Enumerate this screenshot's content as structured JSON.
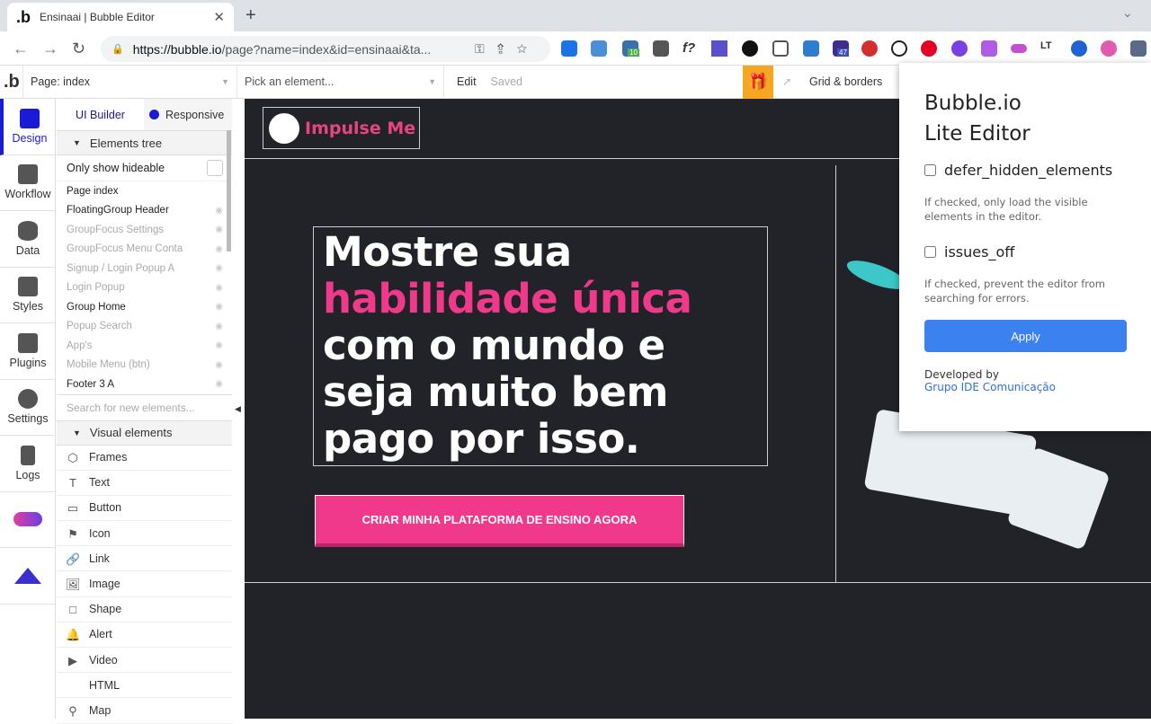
{
  "browser": {
    "tab_title": "Ensinaai | Bubble Editor",
    "url_host": "https://bubble.io",
    "url_path": "/page?name=index&id=ensinaai&ta...",
    "extension_badges": [
      "10",
      "47"
    ]
  },
  "toolbar": {
    "page": "Page: index",
    "pick": "Pick an element...",
    "edit": "Edit",
    "saved": "Saved",
    "grid": "Grid & borders"
  },
  "leftbar": [
    "Design",
    "Workflow",
    "Data",
    "Styles",
    "Plugins",
    "Settings",
    "Logs"
  ],
  "panel": {
    "tab_ui": "UI Builder",
    "tab_responsive": "Responsive",
    "elements_tree": "Elements tree",
    "only_hideable": "Only show hideable",
    "tree": [
      {
        "label": "Page index",
        "dim": false
      },
      {
        "label": "FloatingGroup Header",
        "dim": false
      },
      {
        "label": "GroupFocus Settings",
        "dim": true
      },
      {
        "label": "GroupFocus Menu Conta",
        "dim": true
      },
      {
        "label": "Signup / Login Popup A",
        "dim": true
      },
      {
        "label": "Login Popup",
        "dim": true
      },
      {
        "label": "Group Home",
        "dim": false
      },
      {
        "label": "Popup Search",
        "dim": true
      },
      {
        "label": "App's",
        "dim": true
      },
      {
        "label": "Mobile Menu (btn)",
        "dim": true
      },
      {
        "label": "Footer 3 A",
        "dim": false
      }
    ],
    "search_placeholder": "Search for new elements...",
    "visual_elements": "Visual elements",
    "visual": [
      "Frames",
      "Text",
      "Button",
      "Icon",
      "Link",
      "Image",
      "Shape",
      "Alert",
      "Video",
      "HTML",
      "Map"
    ]
  },
  "canvas": {
    "logo": "Impulse Me",
    "hero_l1": "Mostre sua",
    "hero_l2": "habilidade única",
    "hero_l3": "com o mundo e",
    "hero_l4": "seja muito bem",
    "hero_l5": "pago por isso.",
    "cta": "CRIAR MINHA PLATAFORMA DE ENSINO AGORA"
  },
  "popup": {
    "title1": "Bubble.io",
    "title2": "Lite Editor",
    "opt1": "defer_hidden_elements",
    "desc1": "If checked, only load the visible elements in the editor.",
    "opt2": "issues_off",
    "desc2": "If checked, prevent the editor from searching for errors.",
    "apply": "Apply",
    "developed_by": "Developed by",
    "developer": "Grupo IDE Comunicação"
  },
  "colors": {
    "accent_pink": "#f0398b",
    "apply_blue": "#3b82f0",
    "canvas_bg": "#222328"
  }
}
